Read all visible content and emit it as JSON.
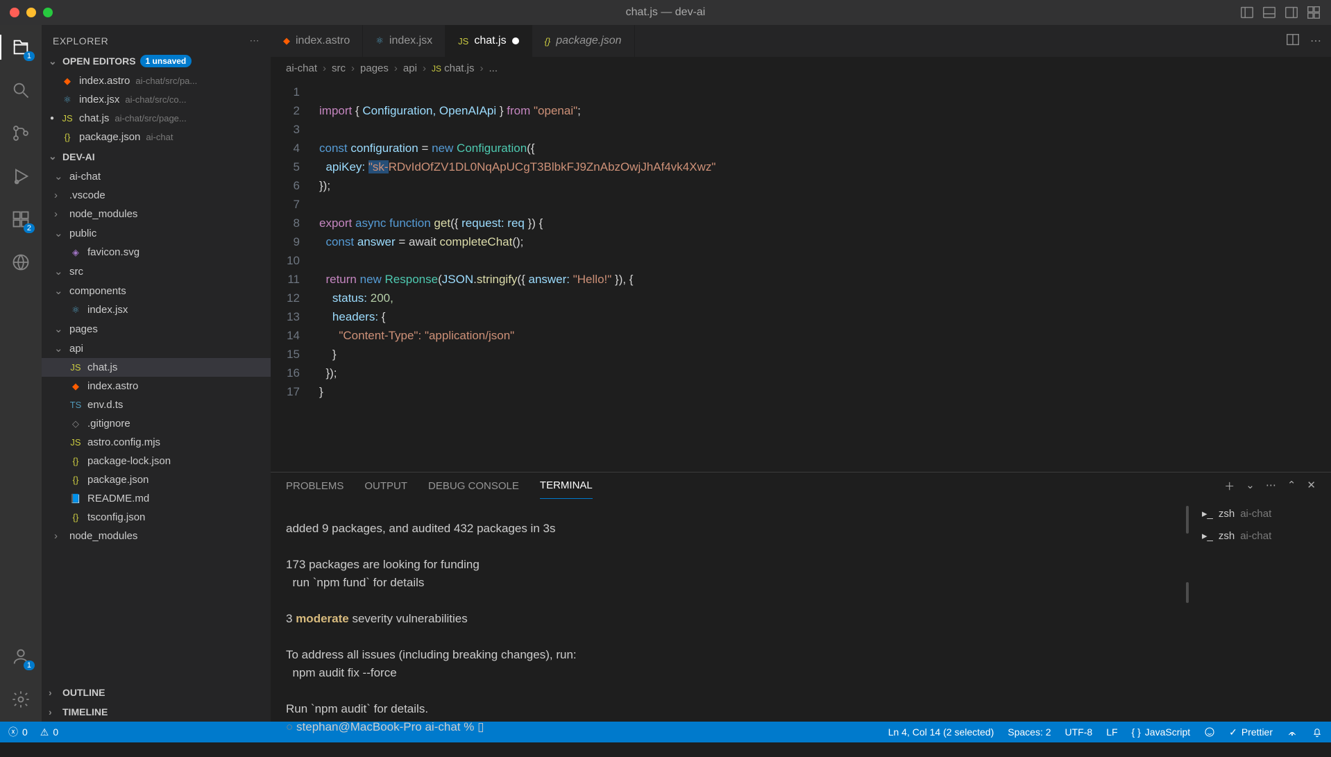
{
  "window": {
    "title": "chat.js — dev-ai"
  },
  "activity_badges": {
    "explorer": "1",
    "extensions": "2",
    "account": "1"
  },
  "sidebar": {
    "title": "EXPLORER",
    "open_editors": {
      "label": "OPEN EDITORS",
      "unsaved": "1 unsaved",
      "items": [
        {
          "icon": "astro",
          "name": "index.astro",
          "path": "ai-chat/src/pa..."
        },
        {
          "icon": "jsx",
          "name": "index.jsx",
          "path": "ai-chat/src/co..."
        },
        {
          "icon": "js",
          "name": "chat.js",
          "path": "ai-chat/src/page...",
          "modified": true
        },
        {
          "icon": "json",
          "name": "package.json",
          "path": "ai-chat"
        }
      ]
    },
    "workspace": {
      "label": "DEV-AI"
    },
    "tree": [
      {
        "depth": 1,
        "chev": "v",
        "icon": "",
        "name": "ai-chat"
      },
      {
        "depth": 2,
        "chev": ">",
        "icon": "",
        "name": ".vscode"
      },
      {
        "depth": 2,
        "chev": ">",
        "icon": "",
        "name": "node_modules"
      },
      {
        "depth": 2,
        "chev": "v",
        "icon": "",
        "name": "public"
      },
      {
        "depth": 3,
        "chev": "",
        "icon": "svg",
        "name": "favicon.svg"
      },
      {
        "depth": 2,
        "chev": "v",
        "icon": "",
        "name": "src"
      },
      {
        "depth": 3,
        "chev": "v",
        "icon": "",
        "name": "components"
      },
      {
        "depth": 4,
        "chev": "",
        "icon": "jsx",
        "name": "index.jsx"
      },
      {
        "depth": 3,
        "chev": "v",
        "icon": "",
        "name": "pages"
      },
      {
        "depth": 4,
        "chev": "v",
        "icon": "",
        "name": "api"
      },
      {
        "depth": 5,
        "chev": "",
        "icon": "js",
        "name": "chat.js",
        "active": true
      },
      {
        "depth": 4,
        "chev": "",
        "icon": "astro",
        "name": "index.astro"
      },
      {
        "depth": 3,
        "chev": "",
        "icon": "ts",
        "name": "env.d.ts"
      },
      {
        "depth": 2,
        "chev": "",
        "icon": "git",
        "name": ".gitignore"
      },
      {
        "depth": 2,
        "chev": "",
        "icon": "js",
        "name": "astro.config.mjs"
      },
      {
        "depth": 2,
        "chev": "",
        "icon": "json",
        "name": "package-lock.json"
      },
      {
        "depth": 2,
        "chev": "",
        "icon": "json",
        "name": "package.json"
      },
      {
        "depth": 2,
        "chev": "",
        "icon": "md",
        "name": "README.md"
      },
      {
        "depth": 2,
        "chev": "",
        "icon": "json",
        "name": "tsconfig.json"
      },
      {
        "depth": 1,
        "chev": ">",
        "icon": "",
        "name": "node_modules"
      }
    ],
    "outline": "OUTLINE",
    "timeline": "TIMELINE"
  },
  "tabs": [
    {
      "icon": "astro",
      "label": "index.astro"
    },
    {
      "icon": "jsx",
      "label": "index.jsx"
    },
    {
      "icon": "js",
      "label": "chat.js",
      "active": true,
      "modified": true
    },
    {
      "icon": "json",
      "label": "package.json",
      "dim": true
    }
  ],
  "breadcrumb": [
    "ai-chat",
    "src",
    "pages",
    "api",
    "chat.js",
    "..."
  ],
  "code": {
    "lines": [
      1,
      2,
      3,
      4,
      5,
      6,
      7,
      8,
      9,
      10,
      11,
      12,
      13,
      14,
      15,
      16,
      17
    ],
    "line1": {
      "import": "import",
      "names": "Configuration, OpenAIApi",
      "from": "from",
      "pkg": "\"openai\""
    },
    "line3": {
      "const": "const",
      "id": "configuration",
      "eq": "=",
      "new": "new",
      "cls": "Configuration"
    },
    "line4": {
      "key": "apiKey:",
      "prefix": "\"sk-",
      "secret": "RDvIdOfZV1DL0NqApUCgT3BlbkFJ9ZnAbzOwjJhAf4vk4Xwz\""
    },
    "line5": "});",
    "line7": {
      "export": "export",
      "async": "async",
      "func": "function",
      "name": "get",
      "param": "request:",
      "alias": "req"
    },
    "line8": {
      "const": "const",
      "id": "answer",
      "eq": "= await",
      "call": "completeChat"
    },
    "line10": {
      "ret": "return",
      "new": "new",
      "cls": "Response",
      "call": "JSON.stringify",
      "key": "answer:",
      "val": "\"Hello!\""
    },
    "line11": {
      "key": "status:",
      "val": "200,"
    },
    "line12": {
      "key": "headers:"
    },
    "line13": {
      "key": "\"Content-Type\":",
      "val": "\"application/json\""
    },
    "line14": "    }",
    "line15": "  });",
    "line16": "}"
  },
  "panel": {
    "tabs": {
      "problems": "PROBLEMS",
      "output": "OUTPUT",
      "debug": "DEBUG CONSOLE",
      "terminal": "TERMINAL"
    },
    "terminal": {
      "l1": "added 9 packages, and audited 432 packages in 3s",
      "l2": "173 packages are looking for funding",
      "l3": "  run `npm fund` for details",
      "l4a": "3 ",
      "l4b": "moderate",
      "l4c": " severity vulnerabilities",
      "l5": "To address all issues (including breaking changes), run:",
      "l6": "  npm audit fix --force",
      "l7": "Run `npm audit` for details.",
      "prompt": "stephan@MacBook-Pro ai-chat % "
    },
    "procs": [
      {
        "shell": "zsh",
        "label": "ai-chat"
      },
      {
        "shell": "zsh",
        "label": "ai-chat"
      }
    ]
  },
  "status": {
    "errors": "0",
    "warnings": "0",
    "cursor": "Ln 4, Col 14 (2 selected)",
    "spaces": "Spaces: 2",
    "encoding": "UTF-8",
    "eol": "LF",
    "lang": "JavaScript",
    "prettier": "Prettier"
  }
}
